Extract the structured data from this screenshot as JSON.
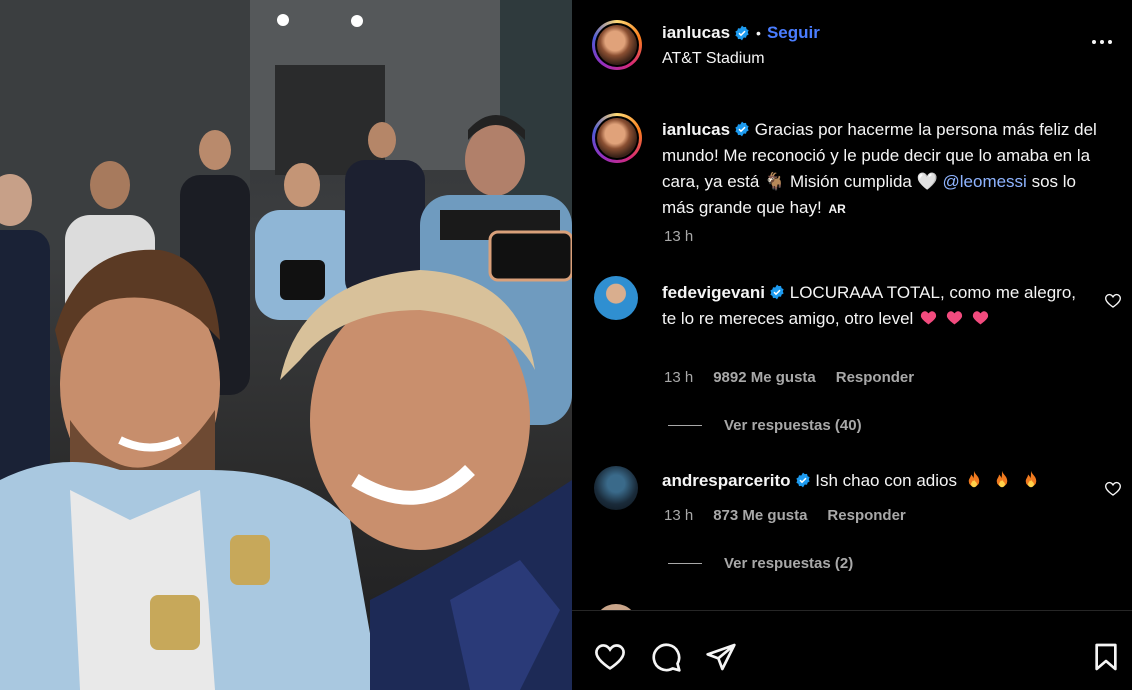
{
  "post": {
    "author": "ianlucas",
    "follow_label": "Seguir",
    "location": "AT&T Stadium",
    "caption_author": "ianlucas",
    "caption_text_1": "Gracias por hacerme la persona más feliz del mundo! Me reconoció y le pude decir que lo amaba en la cara, ya está",
    "caption_emoji_1": "🐐",
    "caption_text_2": "Misión cumplida",
    "caption_emoji_2": "🤍",
    "caption_mention": "@leomessi",
    "caption_text_3": "sos lo más grande que hay!",
    "caption_flag": "AR",
    "caption_time": "13 h"
  },
  "comments": [
    {
      "username": "fedevigevani",
      "text": "LOCURAAA TOTAL, como me alegro, te lo re mereces amigo, otro level",
      "time": "13 h",
      "likes": "9892 Me gusta",
      "reply_label": "Responder",
      "view_replies": "Ver respuestas (40)"
    },
    {
      "username": "andresparcerito",
      "text": "Ish chao con adios",
      "time": "13 h",
      "likes": "873 Me gusta",
      "reply_label": "Responder",
      "view_replies": "Ver respuestas (2)"
    }
  ],
  "icons": {
    "more": "more-options-icon",
    "like": "heart-icon",
    "comment": "comment-icon",
    "share": "share-icon",
    "save": "bookmark-icon"
  },
  "colors": {
    "follow": "#4a7dff",
    "mention": "#8fb4ff",
    "verified": "#1d9bf0",
    "heart_emoji": "#f24b7e",
    "secondary_text": "#a8a8a8"
  }
}
